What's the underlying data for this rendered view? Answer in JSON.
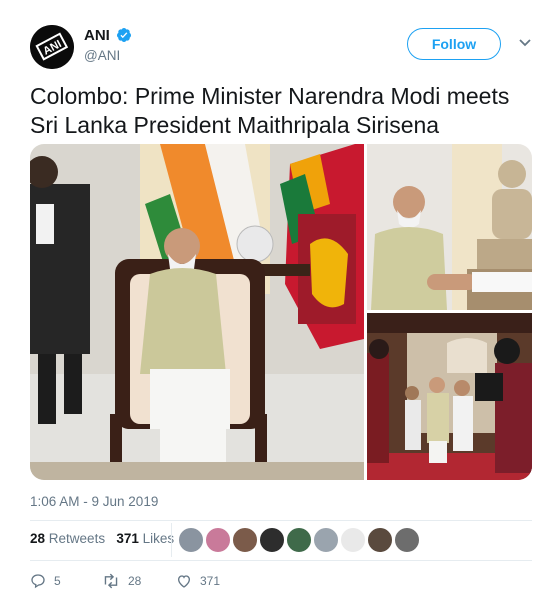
{
  "author": {
    "name": "ANI",
    "handle": "@ANI",
    "verified": true,
    "avatar_text": "ANI"
  },
  "follow_button": {
    "label": "Follow"
  },
  "tweet": {
    "text": "Colombo: Prime Minister Narendra Modi meets Sri Lanka President Maithripala Sirisena"
  },
  "timestamp": "1:06 AM - 9 Jun 2019",
  "stats": {
    "retweets_count": "28",
    "retweets_label": "Retweets",
    "likes_count": "371",
    "likes_label": "Likes"
  },
  "actions": {
    "reply_count": "5",
    "retweet_count": "28",
    "like_count": "371"
  },
  "colors": {
    "accent": "#1da1f2",
    "muted": "#657786",
    "text": "#14171a"
  }
}
